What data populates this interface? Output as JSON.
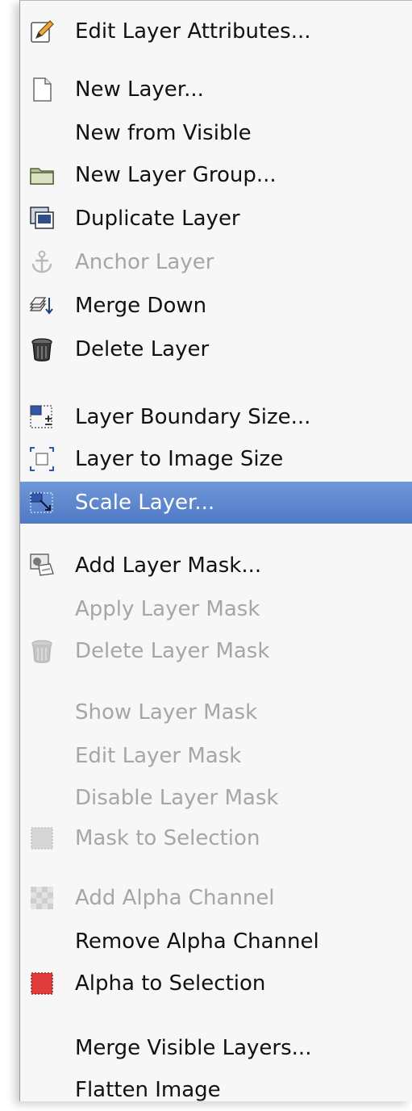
{
  "menu": {
    "items": [
      {
        "label": "Edit Layer Attributes...",
        "icon": "edit-pencil-icon",
        "disabled": false,
        "selected": false
      },
      {
        "label": "New Layer...",
        "icon": "new-page-icon",
        "disabled": false,
        "selected": false
      },
      {
        "label": "New from Visible",
        "icon": "",
        "disabled": false,
        "selected": false
      },
      {
        "label": "New Layer Group...",
        "icon": "folder-icon",
        "disabled": false,
        "selected": false
      },
      {
        "label": "Duplicate Layer",
        "icon": "duplicate-layer-icon",
        "disabled": false,
        "selected": false
      },
      {
        "label": "Anchor Layer",
        "icon": "anchor-icon",
        "disabled": true,
        "selected": false
      },
      {
        "label": "Merge Down",
        "icon": "merge-down-icon",
        "disabled": false,
        "selected": false
      },
      {
        "label": "Delete Layer",
        "icon": "trash-can-icon",
        "disabled": false,
        "selected": false
      },
      {
        "label": "Layer Boundary Size...",
        "icon": "layer-boundary-icon",
        "disabled": false,
        "selected": false
      },
      {
        "label": "Layer to Image Size",
        "icon": "layer-to-image-icon",
        "disabled": false,
        "selected": false
      },
      {
        "label": "Scale Layer...",
        "icon": "scale-layer-icon",
        "disabled": false,
        "selected": true
      },
      {
        "label": "Add Layer Mask...",
        "icon": "add-mask-icon",
        "disabled": false,
        "selected": false
      },
      {
        "label": "Apply Layer Mask",
        "icon": "",
        "disabled": true,
        "selected": false
      },
      {
        "label": "Delete Layer Mask",
        "icon": "trash-can-icon",
        "disabled": true,
        "selected": false
      },
      {
        "label": "Show Layer Mask",
        "icon": "",
        "disabled": true,
        "selected": false
      },
      {
        "label": "Edit Layer Mask",
        "icon": "",
        "disabled": true,
        "selected": false
      },
      {
        "label": "Disable Layer Mask",
        "icon": "",
        "disabled": true,
        "selected": false
      },
      {
        "label": "Mask to Selection",
        "icon": "selection-square-icon",
        "disabled": true,
        "selected": false
      },
      {
        "label": "Add Alpha Channel",
        "icon": "transparency-checker-icon",
        "disabled": true,
        "selected": false
      },
      {
        "label": "Remove Alpha Channel",
        "icon": "",
        "disabled": false,
        "selected": false
      },
      {
        "label": "Alpha to Selection",
        "icon": "alpha-selection-icon",
        "disabled": false,
        "selected": false
      },
      {
        "label": "Merge Visible Layers...",
        "icon": "",
        "disabled": false,
        "selected": false
      },
      {
        "label": "Flatten Image",
        "icon": "",
        "disabled": false,
        "selected": false
      }
    ]
  },
  "colors": {
    "selection_top": "#6f97d8",
    "selection_bottom": "#4f79c6",
    "disabled_text": "#a6a6a6"
  }
}
